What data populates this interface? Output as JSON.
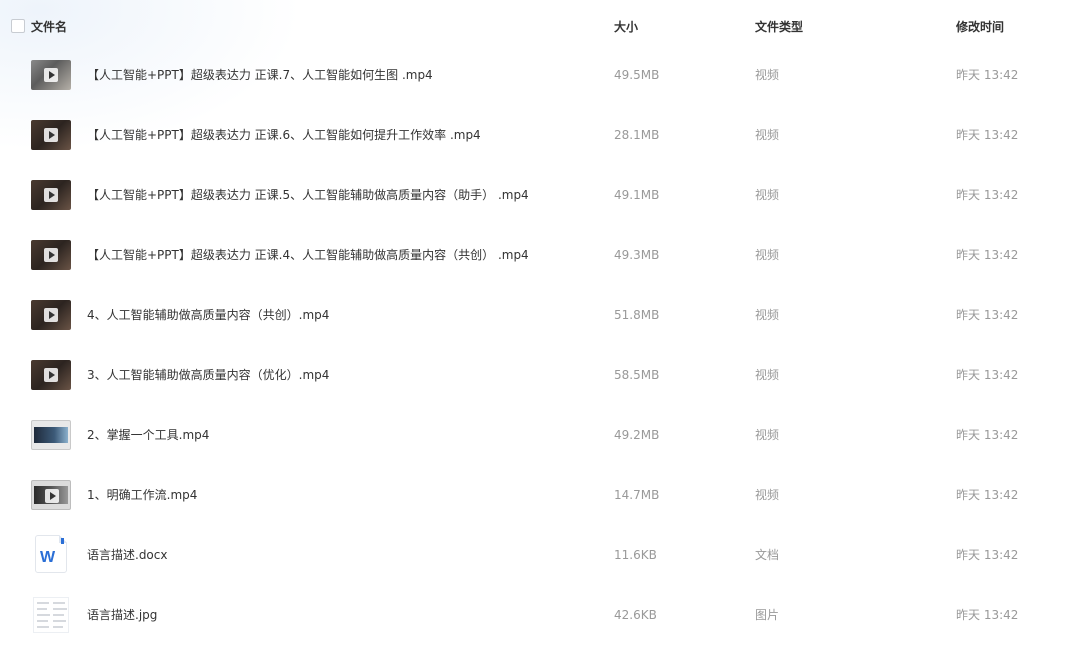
{
  "header": {
    "name_label": "文件名",
    "size_label": "大小",
    "type_label": "文件类型",
    "time_label": "修改时间"
  },
  "files": [
    {
      "name": "【人工智能+PPT】超级表达力 正课.7、人工智能如何生图 .mp4",
      "size": "49.5MB",
      "type": "视频",
      "time": "昨天 13:42",
      "icon": "video-thumbnail-icon"
    },
    {
      "name": "【人工智能+PPT】超级表达力 正课.6、人工智能如何提升工作效率 .mp4",
      "size": "28.1MB",
      "type": "视频",
      "time": "昨天 13:42",
      "icon": "video-thumbnail-icon"
    },
    {
      "name": "【人工智能+PPT】超级表达力 正课.5、人工智能辅助做高质量内容（助手） .mp4",
      "size": "49.1MB",
      "type": "视频",
      "time": "昨天 13:42",
      "icon": "video-thumbnail-icon"
    },
    {
      "name": "【人工智能+PPT】超级表达力 正课.4、人工智能辅助做高质量内容（共创） .mp4",
      "size": "49.3MB",
      "type": "视频",
      "time": "昨天 13:42",
      "icon": "video-thumbnail-icon"
    },
    {
      "name": "4、人工智能辅助做高质量内容（共创）.mp4",
      "size": "51.8MB",
      "type": "视频",
      "time": "昨天 13:42",
      "icon": "video-thumbnail-icon"
    },
    {
      "name": "3、人工智能辅助做高质量内容（优化）.mp4",
      "size": "58.5MB",
      "type": "视频",
      "time": "昨天 13:42",
      "icon": "video-thumbnail-icon"
    },
    {
      "name": "2、掌握一个工具.mp4",
      "size": "49.2MB",
      "type": "视频",
      "time": "昨天 13:42",
      "icon": "video-thumbnail-icon"
    },
    {
      "name": "1、明确工作流.mp4",
      "size": "14.7MB",
      "type": "视频",
      "time": "昨天 13:42",
      "icon": "video-thumbnail-icon"
    },
    {
      "name": "语言描述.docx",
      "size": "11.6KB",
      "type": "文档",
      "time": "昨天 13:42",
      "icon": "word-document-icon",
      "icon_letter": "W"
    },
    {
      "name": "语言描述.jpg",
      "size": "42.6KB",
      "type": "图片",
      "time": "昨天 13:42",
      "icon": "image-thumbnail-icon"
    }
  ]
}
